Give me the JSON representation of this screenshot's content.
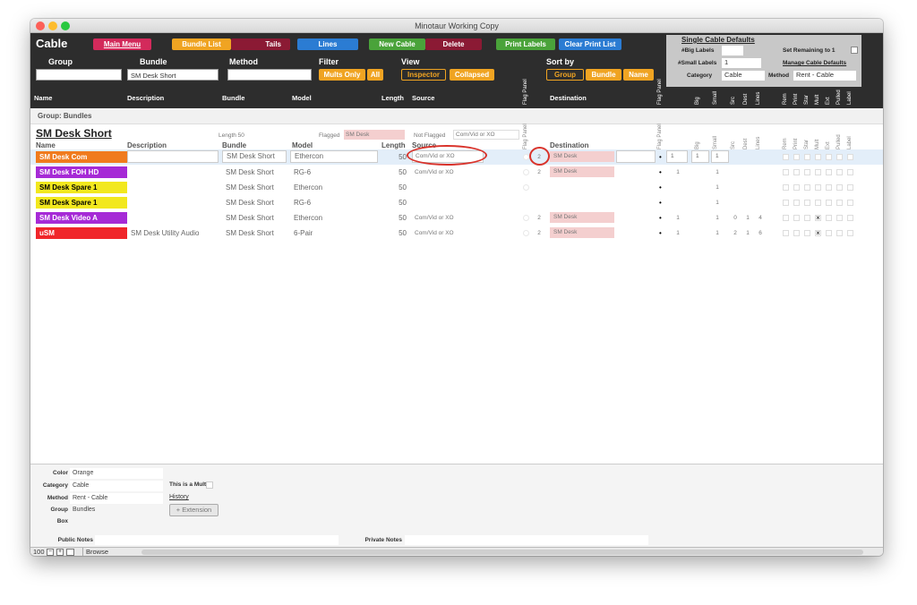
{
  "window": {
    "title": "Minotaur Working Copy"
  },
  "header": {
    "layout_title": "Cable",
    "buttons": {
      "main_menu": "Main Menu",
      "bundle_list": "Bundle List",
      "tails": "Tails",
      "lines": "Lines",
      "new_cable": "New Cable",
      "delete": "Delete",
      "print_labels": "Print Labels",
      "clear_print_list": "Clear Print List"
    },
    "find": {
      "group_label": "Group",
      "group_value": "",
      "bundle_label": "Bundle",
      "bundle_value": "SM Desk Short",
      "method_label": "Method",
      "method_value": "",
      "filter_label": "Filter",
      "mults_only": "Mults Only",
      "all": "All",
      "view_label": "View",
      "inspector": "Inspector",
      "collapsed": "Collapsed",
      "sort_by_label": "Sort by",
      "sort_group": "Group",
      "sort_bundle": "Bundle",
      "sort_name": "Name"
    },
    "defaults": {
      "title": "Single Cable Defaults",
      "big_labels_label": "#Big Labels",
      "big_labels_value": "",
      "small_labels_label": "#Small Labels",
      "small_labels_value": "1",
      "category_label": "Category",
      "category_value": "Cable",
      "set_remaining": "Set Remaining to 1",
      "manage": "Manage Cable Defaults",
      "method_label": "Method",
      "method_value": "Rent - Cable"
    },
    "columns": {
      "name": "Name",
      "description": "Description",
      "bundle": "Bundle",
      "model": "Model",
      "length": "Length",
      "source": "Source",
      "flag_panel": "Flag Panel",
      "destination": "Destination",
      "big": "Big",
      "small": "Small",
      "src": "Src",
      "dest": "Dest",
      "lines": "Lines",
      "rem": "Rem",
      "print": "Print",
      "star": "Star",
      "mult": "Mult",
      "ext": "Ext",
      "pulled": "Pulled",
      "label": "Label"
    }
  },
  "group_row": "Group: Bundles",
  "section": {
    "title": "SM Desk Short",
    "length_text": "Length 50",
    "flagged_label": "Flagged",
    "flagged_value": "SM Desk",
    "not_flagged_label": "Not Flagged",
    "not_flagged_value": "Com/Vid or XO",
    "col_name": "Name",
    "col_description": "Description",
    "col_bundle": "Bundle",
    "col_model": "Model",
    "col_length": "Length",
    "col_source": "Source",
    "col_destination": "Destination"
  },
  "rows": [
    {
      "name": "SM Desk Com",
      "color": "#f07b1d",
      "description": "",
      "bundle": "SM Desk Short",
      "model": "Ethercon",
      "length": "50",
      "source": "Com/Vid or XO",
      "panel": "2",
      "destination": "SM Desk",
      "flag": "•",
      "big": "1",
      "small": "1",
      "src": "",
      "dest": "",
      "lines": "",
      "mult": ""
    },
    {
      "name": "SM Desk FOH HD",
      "color": "#a62ad6",
      "description": "",
      "bundle": "SM Desk Short",
      "model": "RG-6",
      "length": "50",
      "source": "Com/Vid or XO",
      "panel": "2",
      "destination": "SM Desk",
      "flag": "•",
      "big": "1",
      "small": "1",
      "src": "",
      "dest": "",
      "lines": "",
      "mult": ""
    },
    {
      "name": "SM Desk Spare 1",
      "color": "#f2e81e",
      "description": "",
      "bundle": "SM Desk Short",
      "model": "Ethercon",
      "length": "50",
      "source": "",
      "panel": "",
      "destination": "",
      "flag": "•",
      "big": "",
      "small": "1",
      "src": "",
      "dest": "",
      "lines": "",
      "mult": ""
    },
    {
      "name": "SM Desk Spare 1",
      "color": "#f2e81e",
      "description": "",
      "bundle": "SM Desk Short",
      "model": "RG-6",
      "length": "50",
      "source": "",
      "panel": "",
      "destination": "",
      "flag": "•",
      "big": "",
      "small": "1",
      "src": "",
      "dest": "",
      "lines": "",
      "mult": ""
    },
    {
      "name": "SM Desk Video A",
      "color": "#a62ad6",
      "description": "",
      "bundle": "SM Desk Short",
      "model": "Ethercon",
      "length": "50",
      "source": "Com/Vid or XO",
      "panel": "2",
      "destination": "SM Desk",
      "flag": "•",
      "big": "1",
      "small": "1",
      "src": "0",
      "dest": "1",
      "lines": "4",
      "mult": "×"
    },
    {
      "name": "uSM",
      "color": "#f0262a",
      "description": "SM Desk Utility Audio",
      "bundle": "SM Desk Short",
      "model": "6-Pair",
      "length": "50",
      "source": "Com/Vid or XO",
      "panel": "2",
      "destination": "SM Desk",
      "flag": "•",
      "big": "1",
      "small": "1",
      "src": "2",
      "dest": "1",
      "lines": "6",
      "mult": "×"
    }
  ],
  "footer": {
    "color_label": "Color",
    "color_value": "Orange",
    "category_label": "Category",
    "category_value": "Cable",
    "method_label": "Method",
    "method_value": "Rent - Cable",
    "group_label": "Group",
    "group_value": "Bundles",
    "box_label": "Box",
    "mult_label": "This is a Mult",
    "history": "History",
    "extension": "+ Extension",
    "public_notes": "Public Notes",
    "private_notes": "Private Notes"
  },
  "status": {
    "zoom": "100",
    "mode": "Browse"
  }
}
